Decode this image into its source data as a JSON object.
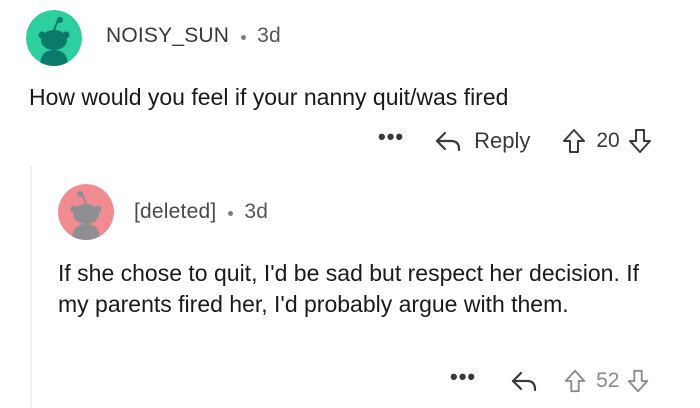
{
  "comments": [
    {
      "author": "NOISY_SUN",
      "age": "3d",
      "avatar_icon": "reddit-snoo-avatar-teal",
      "avatar_color": "#2ccf9e",
      "body": "How would you feel if your nanny quit/was fired",
      "actions": {
        "more_label": "•••",
        "reply_label": "Reply",
        "score": "20"
      }
    },
    {
      "author": "[deleted]",
      "age": "3d",
      "avatar_icon": "reddit-snoo-avatar-pink",
      "avatar_color": "#f28b91",
      "body": "If she chose to quit, I'd be sad but respect her decision. If my parents fired her, I'd probably argue with them.",
      "actions": {
        "more_label": "•••",
        "score": "52"
      }
    }
  ]
}
